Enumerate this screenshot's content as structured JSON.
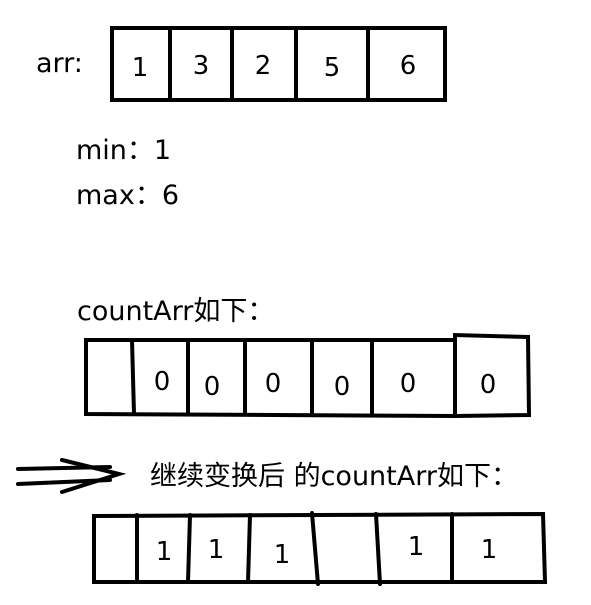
{
  "arr": {
    "label": "arr:",
    "values": [
      "1",
      "3",
      "2",
      "5",
      "6"
    ]
  },
  "stats": {
    "min_text": "min：1",
    "max_text": "max：6"
  },
  "count_arr": {
    "title": "countArr如下：",
    "values": [
      "",
      "0",
      "0",
      "0",
      "0",
      "0",
      "0"
    ]
  },
  "after": {
    "caption": "继续变换后 的countArr如下：",
    "values": [
      "",
      "1",
      "1",
      "1",
      "",
      "1",
      "1"
    ]
  }
}
